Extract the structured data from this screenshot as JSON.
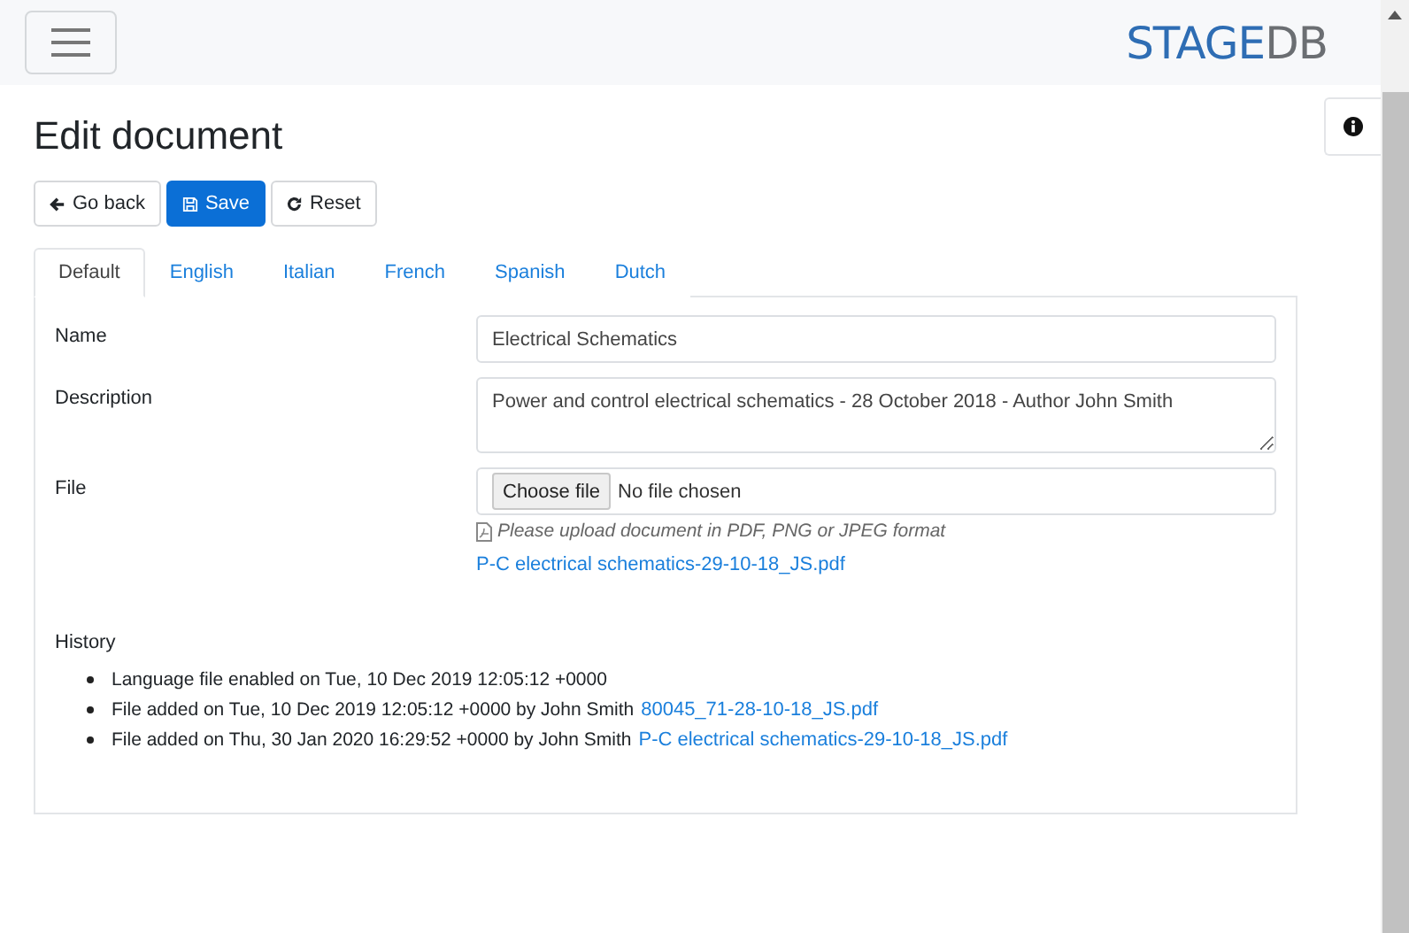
{
  "header": {
    "logo": {
      "primary": "STAGE",
      "secondary": "DB"
    }
  },
  "page": {
    "title": "Edit document"
  },
  "actions": [
    {
      "kind": "back",
      "label": "Go back",
      "primary": false
    },
    {
      "kind": "save",
      "label": "Save",
      "primary": true
    },
    {
      "kind": "reset",
      "label": "Reset",
      "primary": false
    }
  ],
  "tabs": [
    {
      "label": "Default",
      "selected": true
    },
    {
      "label": "English",
      "selected": false
    },
    {
      "label": "Italian",
      "selected": false
    },
    {
      "label": "French",
      "selected": false
    },
    {
      "label": "Spanish",
      "selected": false
    },
    {
      "label": "Dutch",
      "selected": false
    }
  ],
  "form": {
    "name": {
      "label": "Name",
      "value": "Electrical Schematics"
    },
    "description": {
      "label": "Description",
      "value": "Power and control electrical schematics - 28 October 2018 - Author John Smith"
    },
    "file": {
      "label": "File",
      "button": "Choose file",
      "status": "No file chosen",
      "hint": "Please upload document in PDF, PNG or JPEG format",
      "current": "P-C electrical schematics-29-10-18_JS.pdf"
    }
  },
  "history": {
    "title": "History",
    "items": [
      {
        "text": "Language file enabled on Tue, 10 Dec 2019 12:05:12 +0000"
      },
      {
        "text": "File added on Tue, 10 Dec 2019 12:05:12 +0000 by John Smith",
        "link": "80045_71-28-10-18_JS.pdf"
      },
      {
        "text": "File added on Thu, 30 Jan 2020 16:29:52 +0000 by John Smith",
        "link": "P-C electrical schematics-29-10-18_JS.pdf"
      }
    ]
  }
}
